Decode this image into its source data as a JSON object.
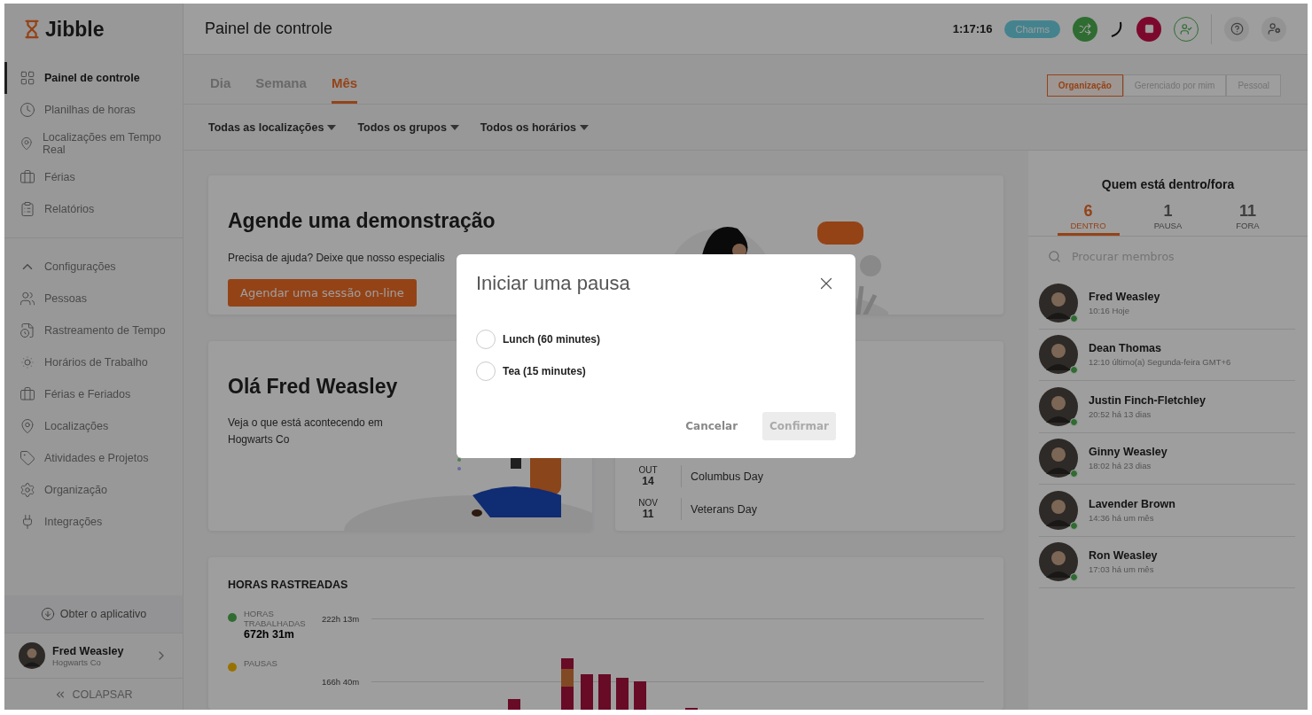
{
  "logo": {
    "text": "Jibble"
  },
  "sidebar": {
    "items": [
      {
        "label": "Painel de controle",
        "selected": true
      },
      {
        "label": "Planilhas de horas",
        "selected": false
      },
      {
        "label": "Localizações em Tempo Real",
        "selected": false
      },
      {
        "label": "Férias",
        "selected": false
      },
      {
        "label": "Relatórios",
        "selected": false
      }
    ],
    "settings": {
      "label": "Configurações",
      "expanded": true,
      "children": [
        {
          "label": "Pessoas"
        },
        {
          "label": "Rastreamento de Tempo"
        },
        {
          "label": "Horários de Trabalho"
        },
        {
          "label": "Férias e Feriados"
        },
        {
          "label": "Localizações"
        },
        {
          "label": "Atividades e Projetos"
        },
        {
          "label": "Organização"
        },
        {
          "label": "Integrações"
        }
      ]
    },
    "get_app": "Obter o aplicativo",
    "user": {
      "name": "Fred Weasley",
      "org": "Hogwarts Co"
    },
    "collapse": "COLAPSAR"
  },
  "header": {
    "title": "Painel de controle",
    "timer": "1:17:16",
    "badge": "Charms"
  },
  "tabs": [
    {
      "label": "Dia",
      "selected": false
    },
    {
      "label": "Semana",
      "selected": false
    },
    {
      "label": "Mês",
      "selected": true
    }
  ],
  "scope": [
    {
      "label": "Organização",
      "selected": true
    },
    {
      "label": "Gerenciado por mim",
      "selected": false
    },
    {
      "label": "Pessoal",
      "selected": false
    }
  ],
  "filters": [
    "Todas as localizações",
    "Todos os grupos",
    "Todos os horários"
  ],
  "demo": {
    "title": "Agende uma demonstração",
    "text": "Precisa de ajuda? Deixe que nosso especialis",
    "button": "Agendar uma sessão on-line"
  },
  "hello": {
    "title": "Olá Fred Weasley",
    "text": "Veja o que está acontecendo em Hogwarts Co"
  },
  "holidays": [
    {
      "month": "OUT",
      "day": "14",
      "name": "Columbus Day"
    },
    {
      "month": "NOV",
      "day": "11",
      "name": "Veterans Day"
    }
  ],
  "tracked": {
    "title": "HORAS RASTREADAS",
    "legend": [
      {
        "label": "HORAS TRABALHADAS",
        "value": "672h 31m",
        "kind": "worked"
      },
      {
        "label": "PAUSAS",
        "kind": "breaks"
      }
    ],
    "ticks": [
      "222h 13m",
      "166h 40m"
    ]
  },
  "who": {
    "title": "Quem está dentro/fora",
    "counters": [
      {
        "count": "6",
        "label": "DENTRO",
        "selected": true
      },
      {
        "count": "1",
        "label": "PAUSA",
        "selected": false
      },
      {
        "count": "11",
        "label": "FORA",
        "selected": false
      }
    ],
    "search": {
      "placeholder": "Procurar membros"
    },
    "members": [
      {
        "name": "Fred Weasley",
        "status": "10:16 Hoje",
        "online": true
      },
      {
        "name": "Dean Thomas",
        "status": "12:10 último(a) Segunda-feira GMT+6",
        "online": true
      },
      {
        "name": "Justin Finch-Fletchley",
        "status": "20:52 há 13 dias",
        "online": true
      },
      {
        "name": "Ginny Weasley",
        "status": "18:02 há 23 dias",
        "online": true
      },
      {
        "name": "Lavender Brown",
        "status": "14:36 há um mês",
        "online": true
      },
      {
        "name": "Ron Weasley",
        "status": "17:03 há um mês",
        "online": true
      }
    ]
  },
  "modal": {
    "title": "Iniciar uma pausa",
    "options": [
      {
        "label": "Lunch (60 minutes)",
        "selected": false
      },
      {
        "label": "Tea (15 minutes)",
        "selected": false
      }
    ],
    "cancel": "Cancelar",
    "confirm": {
      "label": "Confirmar",
      "disabled": true
    }
  }
}
